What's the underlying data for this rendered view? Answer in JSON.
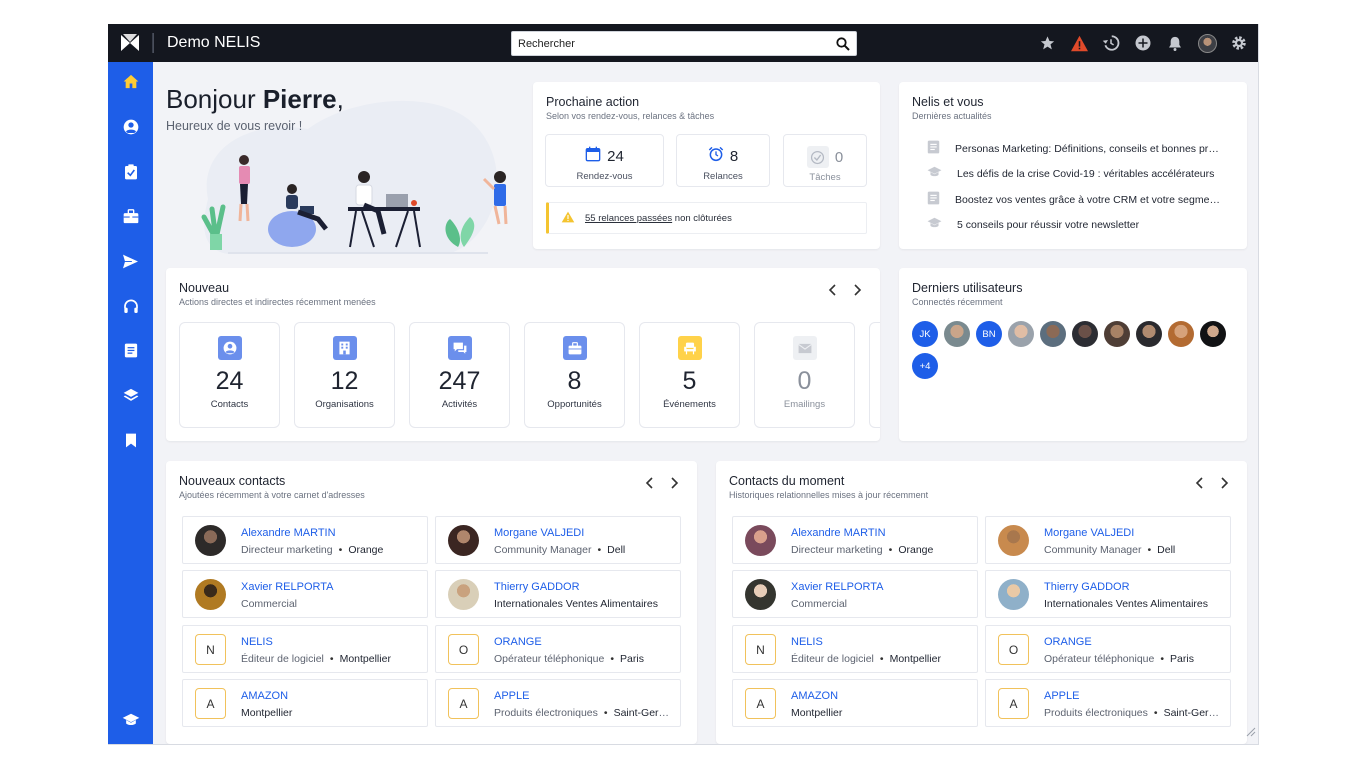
{
  "app": {
    "title": "Demo NELIS"
  },
  "search": {
    "placeholder": "Rechercher"
  },
  "topbar_icons": [
    "star-icon",
    "warning-icon",
    "history-icon",
    "add-icon",
    "bell-icon",
    "user-avatar",
    "gear-icon"
  ],
  "sidebar": [
    "home-icon",
    "contact-icon",
    "tasks-icon",
    "briefcase-icon",
    "send-icon",
    "headset-icon",
    "document-icon",
    "layers-icon",
    "bookmark-icon",
    "graduation-icon"
  ],
  "welcome": {
    "greeting": "Bonjour ",
    "name": "Pierre",
    "comma": ",",
    "subtitle": "Heureux de vous revoir !"
  },
  "next_action": {
    "title": "Prochaine action",
    "subtitle": "Selon vos rendez-vous, relances & tâches",
    "stats": [
      {
        "value": "24",
        "label": "Rendez-vous"
      },
      {
        "value": "8",
        "label": "Relances"
      },
      {
        "value": "0",
        "label": "Tâches"
      }
    ],
    "alert_link": "55 relances passées",
    "alert_rest": "non clôturées"
  },
  "nelis_news": {
    "title": "Nelis et vous",
    "subtitle": "Dernières actualités",
    "items": [
      "Personas Marketing: Définitions, conseils et bonnes pratiques",
      "Les défis de la crise Covid-19 : véritables accélérateurs",
      "Boostez vos ventes grâce à votre CRM et votre segmentation",
      "5 conseils pour réussir votre newsletter"
    ]
  },
  "nouveau": {
    "title": "Nouveau",
    "subtitle": "Actions directes et indirectes récemment menées",
    "tiles": [
      {
        "value": "24",
        "label": "Contacts"
      },
      {
        "value": "12",
        "label": "Organisations"
      },
      {
        "value": "247",
        "label": "Activités"
      },
      {
        "value": "8",
        "label": "Opportunités"
      },
      {
        "value": "5",
        "label": "Événements"
      },
      {
        "value": "0",
        "label": "Emailings"
      }
    ]
  },
  "users": {
    "title": "Derniers utilisateurs",
    "subtitle": "Connectés récemment",
    "initials": [
      "JK",
      "BN"
    ],
    "more": "+4"
  },
  "new_contacts": {
    "title": "Nouveaux contacts",
    "subtitle": "Ajoutées récemment à votre carnet d'adresses",
    "items": [
      {
        "name": "Alexandre MARTIN",
        "role": "Directeur marketing",
        "extra": "Orange"
      },
      {
        "name": "Morgane VALJEDI",
        "role": "Community Manager",
        "extra": "Dell"
      },
      {
        "name": "Xavier RELPORTA",
        "role": "Commercial",
        "extra": ""
      },
      {
        "name": "Thierry GADDOR",
        "role": "Internationales Ventes Alimentaires",
        "extra": ""
      },
      {
        "letter": "N",
        "name": "NELIS",
        "role": "Éditeur de logiciel",
        "extra": "Montpellier"
      },
      {
        "letter": "O",
        "name": "ORANGE",
        "role": "Opérateur téléphonique",
        "extra": "Paris"
      },
      {
        "letter": "A",
        "name": "AMAZON",
        "role": "Montpellier",
        "extra": ""
      },
      {
        "letter": "A",
        "name": "APPLE",
        "role": "Produits électroniques",
        "extra": "Saint-Germain"
      }
    ]
  },
  "moment_contacts": {
    "title": "Contacts du moment",
    "subtitle": "Historiques relationnelles mises à jour récemment",
    "items": [
      {
        "name": "Alexandre MARTIN",
        "role": "Directeur marketing",
        "extra": "Orange"
      },
      {
        "name": "Morgane VALJEDI",
        "role": "Community Manager",
        "extra": "Dell"
      },
      {
        "name": "Xavier RELPORTA",
        "role": "Commercial",
        "extra": ""
      },
      {
        "name": "Thierry GADDOR",
        "role": "Internationales Ventes Alimentaires",
        "extra": ""
      },
      {
        "letter": "N",
        "name": "NELIS",
        "role": "Éditeur de logiciel",
        "extra": "Montpellier"
      },
      {
        "letter": "O",
        "name": "ORANGE",
        "role": "Opérateur téléphonique",
        "extra": "Paris"
      },
      {
        "letter": "A",
        "name": "AMAZON",
        "role": "Montpellier",
        "extra": ""
      },
      {
        "letter": "A",
        "name": "APPLE",
        "role": "Produits électroniques",
        "extra": "Saint-Germain"
      }
    ]
  }
}
